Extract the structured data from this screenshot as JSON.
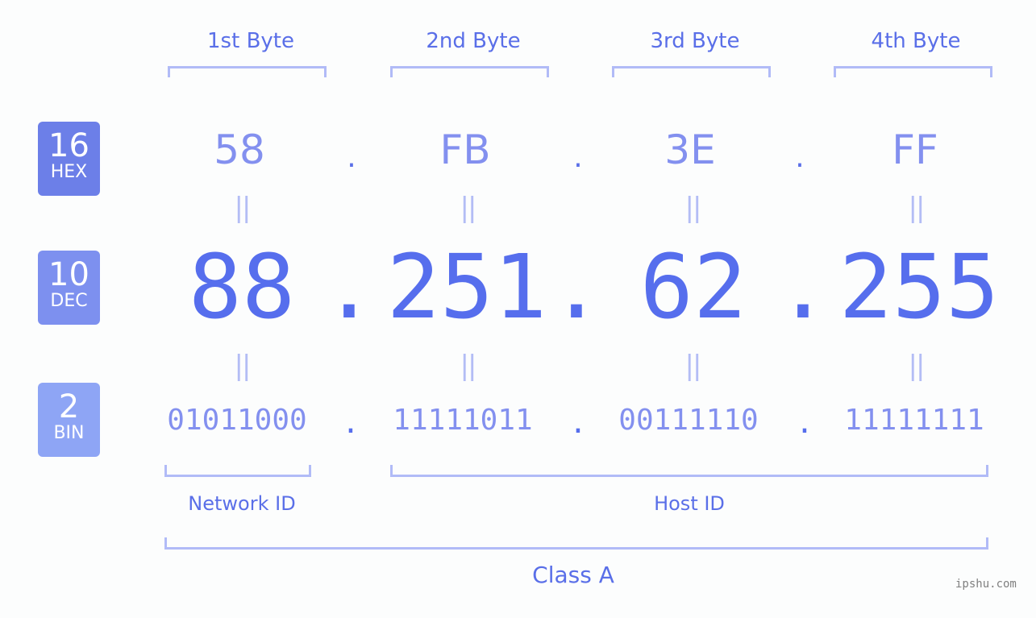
{
  "bytes": {
    "labels": [
      "1st Byte",
      "2nd Byte",
      "3rd Byte",
      "4th Byte"
    ]
  },
  "badges": {
    "hex": {
      "num": "16",
      "label": "HEX",
      "color": "#6c7fe8"
    },
    "dec": {
      "num": "10",
      "label": "DEC",
      "color": "#7d90ef"
    },
    "bin": {
      "num": "2",
      "label": "BIN",
      "color": "#8ea5f5"
    }
  },
  "hex": {
    "values": [
      "58",
      "FB",
      "3E",
      "FF"
    ]
  },
  "dec": {
    "values": [
      "88",
      "251",
      "62",
      "255"
    ]
  },
  "bin": {
    "values": [
      "01011000",
      "11111011",
      "00111110",
      "11111111"
    ]
  },
  "separator": ".",
  "equals": "||",
  "parts": {
    "network": "Network ID",
    "host": "Host ID",
    "class": "Class A"
  },
  "colors": {
    "accent": "#566eed",
    "light": "#8390ef",
    "bracket": "#b1bbf7"
  },
  "watermark": "ipshu.com"
}
